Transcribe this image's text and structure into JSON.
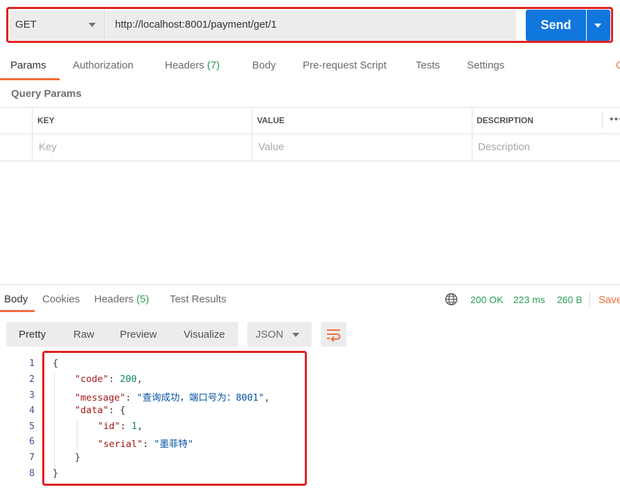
{
  "request": {
    "method": "GET",
    "url": "http://localhost:8001/payment/get/1",
    "send_label": "Send"
  },
  "request_tabs": [
    {
      "label": "Params",
      "active": true
    },
    {
      "label": "Authorization"
    },
    {
      "label": "Headers",
      "count": "(7)"
    },
    {
      "label": "Body"
    },
    {
      "label": "Pre-request Script"
    },
    {
      "label": "Tests"
    },
    {
      "label": "Settings"
    }
  ],
  "query_params": {
    "title": "Query Params",
    "columns": [
      "KEY",
      "VALUE",
      "DESCRIPTION"
    ],
    "placeholders": [
      "Key",
      "Value",
      "Description"
    ],
    "more": "•••"
  },
  "response_tabs": [
    {
      "label": "Body",
      "active": true
    },
    {
      "label": "Cookies"
    },
    {
      "label": "Headers",
      "count": "(5)"
    },
    {
      "label": "Test Results"
    }
  ],
  "response_status": {
    "status": "200 OK",
    "time": "223 ms",
    "size": "260 B",
    "save_label": "Save"
  },
  "response_toolbar": {
    "view_modes": [
      "Pretty",
      "Raw",
      "Preview",
      "Visualize"
    ],
    "active_view": "Pretty",
    "format": "JSON"
  },
  "response_body": {
    "line_numbers": [
      "1",
      "2",
      "3",
      "4",
      "5",
      "6",
      "7",
      "8"
    ],
    "open_brace": "{",
    "code_key": "\"code\"",
    "code_value": "200",
    "message_key": "\"message\"",
    "message_value": "\"查询成功，端口号为：8001\"",
    "data_key": "\"data\"",
    "id_key": "\"id\"",
    "id_value": "1",
    "serial_key": "\"serial\"",
    "serial_value": "\"墨菲特\"",
    "inner_close": "}",
    "close_brace": "}"
  },
  "colors": {
    "accent": "#f26b3a",
    "send_blue": "#1177dd",
    "status_green": "#2b9b55",
    "highlight_red": "#e02020"
  },
  "icons": [
    "chevron-down-icon",
    "globe-icon",
    "wrap-lines-icon"
  ]
}
